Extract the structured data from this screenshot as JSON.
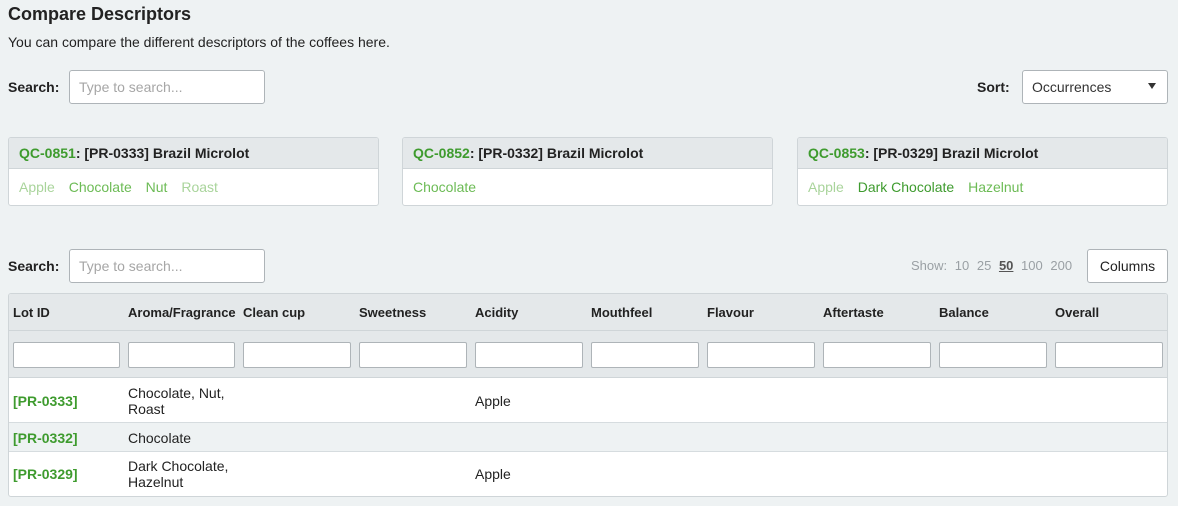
{
  "page": {
    "title": "Compare Descriptors",
    "subtitle": "You can compare the different descriptors of the coffees here."
  },
  "top_search": {
    "label": "Search:",
    "placeholder": "Type to search..."
  },
  "sort": {
    "label": "Sort:",
    "value": "Occurrences"
  },
  "cards": [
    {
      "code": "QC-0851",
      "title": ": [PR-0333] Brazil Microlot",
      "descriptors": [
        {
          "text": "Apple",
          "shade": "light"
        },
        {
          "text": "Chocolate",
          "shade": "mid"
        },
        {
          "text": "Nut",
          "shade": "mid"
        },
        {
          "text": "Roast",
          "shade": "light"
        }
      ]
    },
    {
      "code": "QC-0852",
      "title": ": [PR-0332] Brazil Microlot",
      "descriptors": [
        {
          "text": "Chocolate",
          "shade": "mid"
        }
      ]
    },
    {
      "code": "QC-0853",
      "title": ": [PR-0329] Brazil Microlot",
      "descriptors": [
        {
          "text": "Apple",
          "shade": "light"
        },
        {
          "text": "Dark Chocolate",
          "shade": "dark"
        },
        {
          "text": "Hazelnut",
          "shade": "mid"
        }
      ]
    }
  ],
  "table_search": {
    "label": "Search:",
    "placeholder": "Type to search..."
  },
  "show": {
    "label": "Show:",
    "options": [
      "10",
      "25",
      "50",
      "100",
      "200"
    ],
    "selected": "50"
  },
  "columns_button": "Columns",
  "table": {
    "headers": [
      "Lot ID",
      "Aroma/Fragrance",
      "Clean cup",
      "Sweetness",
      "Acidity",
      "Mouthfeel",
      "Flavour",
      "Aftertaste",
      "Balance",
      "Overall"
    ],
    "rows": [
      [
        "[PR-0333]",
        "Chocolate, Nut, Roast",
        "",
        "",
        "Apple",
        "",
        "",
        "",
        "",
        ""
      ],
      [
        "[PR-0332]",
        "Chocolate",
        "",
        "",
        "",
        "",
        "",
        "",
        "",
        ""
      ],
      [
        "[PR-0329]",
        "Dark Chocolate, Hazelnut",
        "",
        "",
        "Apple",
        "",
        "",
        "",
        "",
        ""
      ]
    ]
  },
  "colors": {
    "accent_green": "#3e9b2e",
    "light_green": "#a9d49b",
    "mid_green": "#6cbb55",
    "header_bg": "#e4e8ea",
    "page_bg": "#eef2f3"
  }
}
